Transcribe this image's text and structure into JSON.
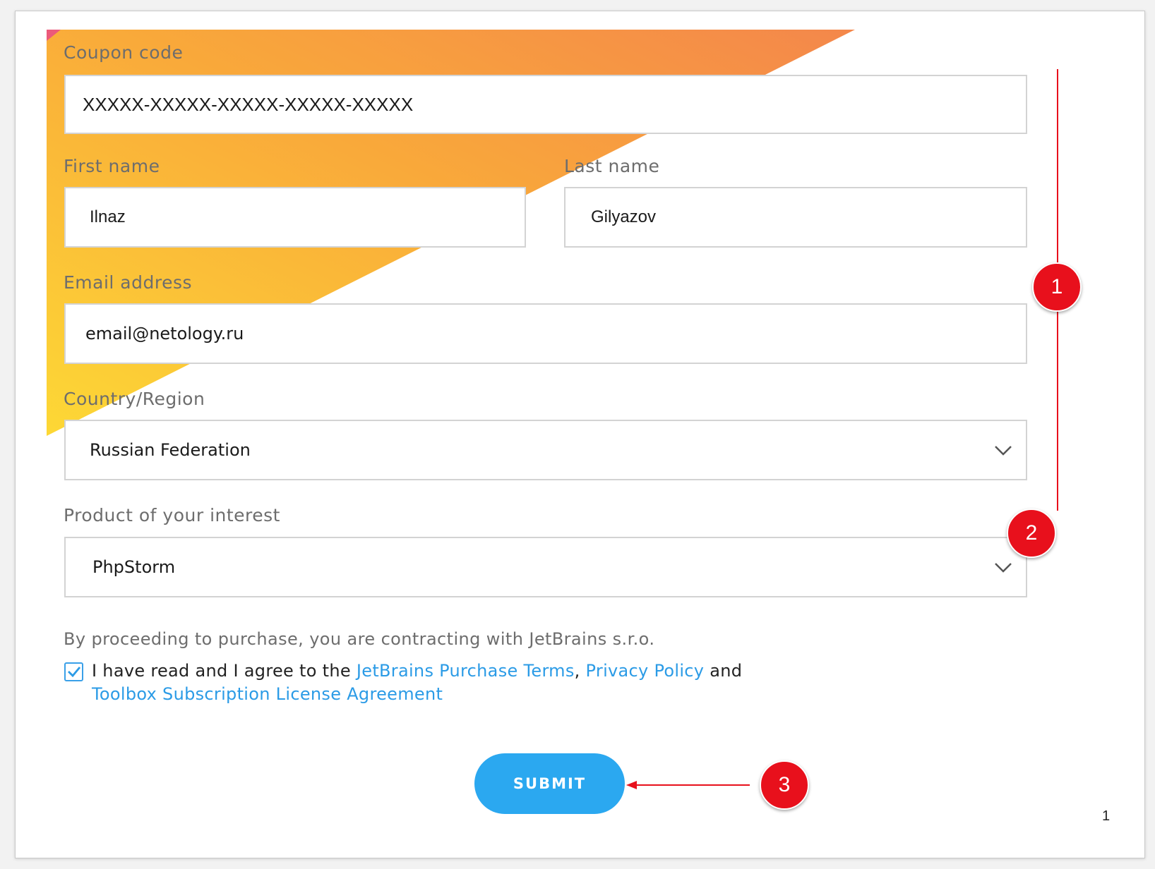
{
  "form": {
    "coupon": {
      "label": "Coupon code",
      "value": "XXXXX-XXXXX-XXXXX-XXXXX-XXXXX"
    },
    "first_name": {
      "label": "First name",
      "value": "Ilnaz"
    },
    "last_name": {
      "label": "Last name",
      "value": "Gilyazov"
    },
    "email": {
      "label": "Email address",
      "value": "email@netology.ru"
    },
    "country": {
      "label": "Country/Region",
      "selected": "Russian Federation"
    },
    "product": {
      "label": "Product of your interest",
      "selected": "PhpStorm"
    },
    "legal_text": "By proceeding to purchase, you are contracting with JetBrains s.r.o.",
    "agreement": {
      "checked": true,
      "prefix": "I have read and I agree to the",
      "link_purchase_terms": "JetBrains Purchase Terms",
      "comma": ",",
      "link_privacy": "Privacy Policy",
      "and": "and",
      "link_toolbox": "Toolbox Subscription License Agreement"
    },
    "submit_label": "SUBMIT"
  },
  "annotations": {
    "badge_1": "1",
    "badge_2": "2",
    "badge_3": "3",
    "color": "#e8101c"
  },
  "page_number": "1",
  "colors": {
    "accent": "#2ba8f0",
    "link": "#2b9be6",
    "gradient_start": "#fdd835",
    "gradient_end": "#f4874b"
  }
}
